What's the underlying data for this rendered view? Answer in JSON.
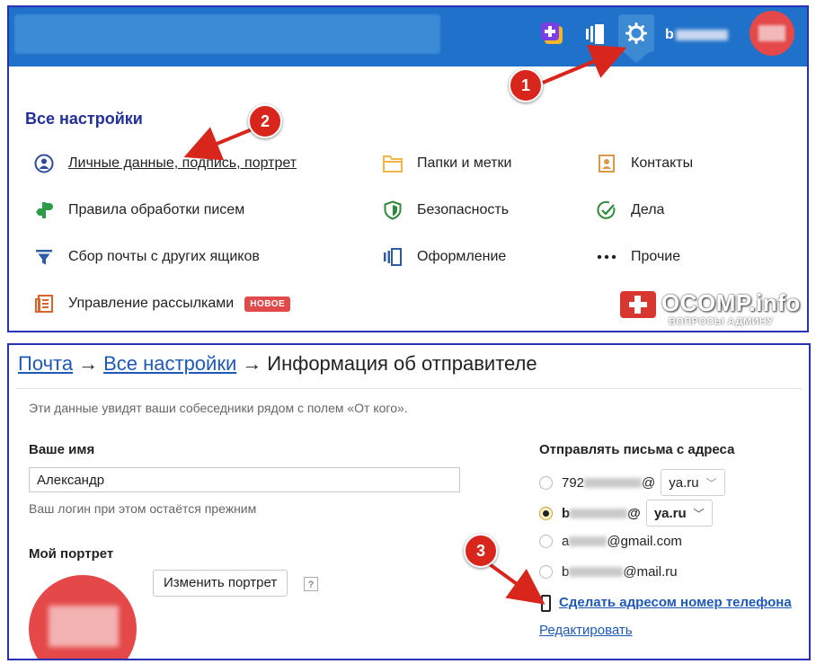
{
  "header": {
    "username_visible": "b",
    "avatar_label": "avatar"
  },
  "settings": {
    "title": "Все настройки",
    "items": [
      {
        "label": "Личные данные, подпись, портрет",
        "icon": "person-circle-icon"
      },
      {
        "label": "Правила обработки писем",
        "icon": "filter-rule-icon"
      },
      {
        "label": "Сбор почты с других ящиков",
        "icon": "funnel-icon"
      },
      {
        "label": "Управление рассылками",
        "icon": "newsletter-icon",
        "badge": "НОВОЕ"
      },
      {
        "label": "Папки и метки",
        "icon": "folder-icon"
      },
      {
        "label": "Безопасность",
        "icon": "shield-icon"
      },
      {
        "label": "Оформление",
        "icon": "theme-icon"
      },
      {
        "label": "Контакты",
        "icon": "contacts-icon"
      },
      {
        "label": "Дела",
        "icon": "check-circle-icon"
      },
      {
        "label": "Прочие",
        "icon": "dots-icon"
      }
    ]
  },
  "callouts": [
    "1",
    "2",
    "3"
  ],
  "watermark": {
    "title": "OCOMP.info",
    "subtitle": "ВОПРОСЫ АДМИНУ"
  },
  "breadcrumb": {
    "mail": "Почта",
    "separator": "→",
    "all_settings": "Все настройки",
    "current": "Информация об отправителе"
  },
  "sender": {
    "info_text": "Эти данные увидят ваши собеседники рядом с полем «От кого».",
    "name_label": "Ваше имя",
    "name_value": "Александр",
    "name_hint": "Ваш логин при этом остаётся прежним",
    "portrait_label": "Мой портрет",
    "change_portrait": "Изменить портрет",
    "help": "?"
  },
  "addresses": {
    "title": "Отправлять письма с адреса",
    "rows": [
      {
        "prefix": "792",
        "suffix": "@",
        "domain": "ya.ru",
        "selected": false
      },
      {
        "prefix": "b",
        "suffix": "@",
        "domain": "ya.ru",
        "selected": true
      },
      {
        "prefix": "a",
        "suffix": "@gmail.com",
        "selected": false
      },
      {
        "prefix": "b",
        "suffix": "@mail.ru",
        "selected": false
      }
    ],
    "phone_link": "Сделать адресом номер телефона",
    "edit_link": "Редактировать"
  },
  "colors": {
    "header_blue": "#1f71c9",
    "title_blue": "#232f9a",
    "link_blue": "#1f59b8",
    "accent_red": "#d9261c",
    "badge_red": "#e04a4a"
  }
}
